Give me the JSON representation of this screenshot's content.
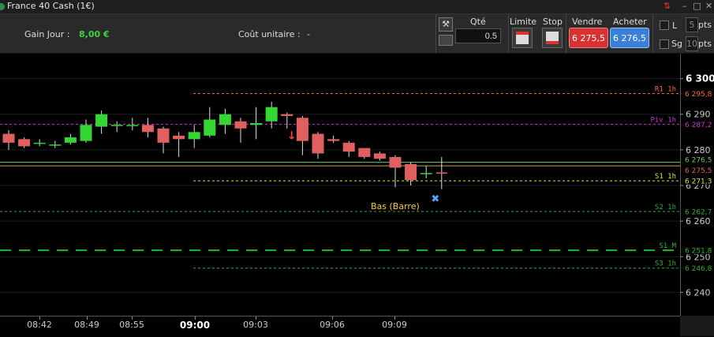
{
  "window": {
    "title": "France 40 Cash (1€)"
  },
  "toolbar": {
    "gain_label": "Gain Jour :",
    "gain_value": "8,00 €",
    "cout_label": "Coût unitaire :",
    "cout_value": "-",
    "qty_header": "Qté",
    "qty_value": "0.5",
    "limit_header": "Limite",
    "stop_header": "Stop",
    "sell_header": "Vendre",
    "sell_price": "6 275,5",
    "buy_header": "Acheter",
    "buy_price": "6 276,5",
    "l_label": "L",
    "sg_label": "Sg",
    "pts_value_1": "5",
    "pts_label_1": "pts",
    "pts_value_2": "10",
    "pts_label_2": "pts"
  },
  "colors": {
    "up_candle": "#33d633",
    "down_candle": "#e06060",
    "r1": "#ff6633",
    "piv": "#cc33cc",
    "s1": "#ccee33",
    "s2": "#33aa33",
    "s1m": "#22bb22",
    "s3": "#33aa33",
    "current": "#66cc66"
  },
  "chart_data": {
    "type": "candlestick",
    "x_ticks": [
      "08:42",
      "08:49",
      "08:55",
      "09:00",
      "09:03",
      "09:06",
      "09:09"
    ],
    "y_ticks": [
      "6 300",
      "6 290",
      "6 280",
      "6 270",
      "6 260",
      "6 250",
      "6 240"
    ],
    "ylim": [
      6233,
      6307
    ],
    "candles": [
      {
        "o": 6284.5,
        "h": 6285.5,
        "l": 6280,
        "c": 6282
      },
      {
        "o": 6283,
        "h": 6283.5,
        "l": 6280.5,
        "c": 6281
      },
      {
        "o": 6282,
        "h": 6283,
        "l": 6281,
        "c": 6282
      },
      {
        "o": 6281.5,
        "h": 6282.5,
        "l": 6280.5,
        "c": 6281.5
      },
      {
        "o": 6282,
        "h": 6284.5,
        "l": 6281.5,
        "c": 6283.5
      },
      {
        "o": 6282.5,
        "h": 6288.5,
        "l": 6282,
        "c": 6287
      },
      {
        "o": 6286.5,
        "h": 6291,
        "l": 6284.5,
        "c": 6290
      },
      {
        "o": 6287,
        "h": 6288,
        "l": 6285,
        "c": 6287
      },
      {
        "o": 6287,
        "h": 6289,
        "l": 6285.5,
        "c": 6287
      },
      {
        "o": 6287,
        "h": 6289,
        "l": 6283.5,
        "c": 6285
      },
      {
        "o": 6286,
        "h": 6286.5,
        "l": 6279,
        "c": 6282
      },
      {
        "o": 6284,
        "h": 6285,
        "l": 6278,
        "c": 6283
      },
      {
        "o": 6283,
        "h": 6287,
        "l": 6280.5,
        "c": 6285
      },
      {
        "o": 6284,
        "h": 6292,
        "l": 6283.5,
        "c": 6288.5
      },
      {
        "o": 6287,
        "h": 6291.5,
        "l": 6284.5,
        "c": 6290
      },
      {
        "o": 6288,
        "h": 6289,
        "l": 6282,
        "c": 6286
      },
      {
        "o": 6287,
        "h": 6292,
        "l": 6283,
        "c": 6287.5
      },
      {
        "o": 6288,
        "h": 6293.5,
        "l": 6286,
        "c": 6292
      },
      {
        "o": 6290,
        "h": 6290.5,
        "l": 6286,
        "c": 6289.5
      },
      {
        "o": 6289,
        "h": 6289.5,
        "l": 6278.5,
        "c": 6282.5
      },
      {
        "o": 6284.5,
        "h": 6285,
        "l": 6277.5,
        "c": 6279
      },
      {
        "o": 6283,
        "h": 6284,
        "l": 6282,
        "c": 6282.5
      },
      {
        "o": 6282,
        "h": 6282.5,
        "l": 6278,
        "c": 6279.5
      },
      {
        "o": 6280.5,
        "h": 6280.5,
        "l": 6277.5,
        "c": 6278
      },
      {
        "o": 6279,
        "h": 6279.5,
        "l": 6277,
        "c": 6277.5
      },
      {
        "o": 6278,
        "h": 6278.5,
        "l": 6269.5,
        "c": 6275
      },
      {
        "o": 6276,
        "h": 6276.5,
        "l": 6270,
        "c": 6271.5
      },
      {
        "o": 6273.5,
        "h": 6275.5,
        "l": 6272,
        "c": 6273.5
      }
    ],
    "levels": [
      {
        "name": "R1 1h",
        "value": 6295.8,
        "label": "6 295,8",
        "style": "r1"
      },
      {
        "name": "Piv 1h",
        "value": 6287.2,
        "label": "6 287,2",
        "style": "piv"
      },
      {
        "name": "S1 1h",
        "value": 6271.3,
        "label": "6 271,3",
        "style": "s1"
      },
      {
        "name": "S2 1h",
        "value": 6262.7,
        "label": "6 262,7",
        "style": "s2"
      },
      {
        "name": "S1 M",
        "value": 6251.8,
        "label": "6 251,8",
        "style": "s1m"
      },
      {
        "name": "S3 1h",
        "value": 6246.8,
        "label": "6 246,8",
        "style": "s3"
      }
    ],
    "current_price": {
      "value": 6275.5,
      "label": "6 275,5"
    },
    "bid_line": {
      "value": 6276.5,
      "label": "6 276,5"
    },
    "annotation": "Bas (Barre)"
  }
}
